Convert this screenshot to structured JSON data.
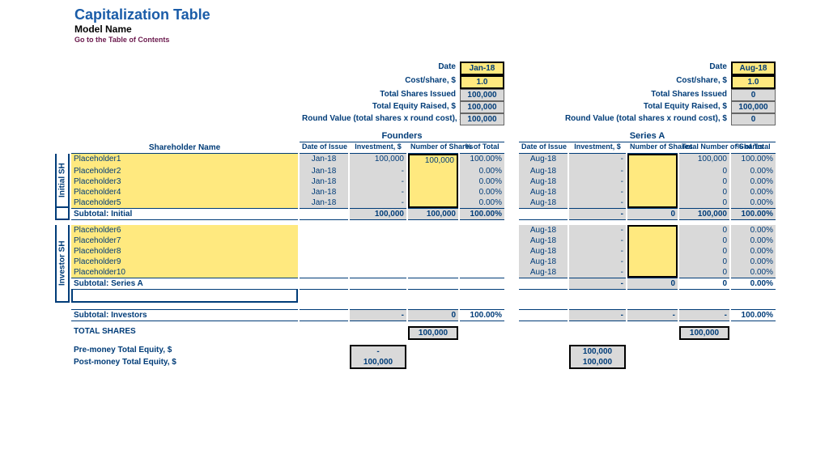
{
  "header": {
    "title": "Capitalization Table",
    "subtitle": "Model Name",
    "toc": "Go to the Table of Contents"
  },
  "labels": {
    "date": "Date",
    "cost": "Cost/share, $",
    "totalShares": "Total Shares Issued",
    "totalEquity": "Total Equity Raised, $",
    "roundValue": "Round Value (total shares x round cost), $",
    "founders": "Founders",
    "seriesA": "Series A",
    "shareholderName": "Shareholder Name",
    "dateOfIssue": "Date of Issue",
    "investment": "Investment, $",
    "numberOfShares": "Number of Shares",
    "totalNumberOfShares": "Total Number of Shares",
    "pctOfTotal": "% of Total",
    "initialSH": "Initial SH",
    "investorSH": "Investor SH",
    "subtotalInitial": "Subtotal: Initial",
    "subtotalSeriesA": "Subtotal: Series A",
    "subtotalInvestors": "Subtotal: Investors",
    "totalSharesLabel": "TOTAL SHARES",
    "preMoney": "Pre-money Total Equity, $",
    "postMoney": "Post-money Total Equity, $"
  },
  "founders": {
    "date": "Jan-18",
    "cost": "1.0",
    "totalShares": "100,000",
    "totalEquity": "100,000",
    "roundValue": "100,000"
  },
  "seriesA": {
    "date": "Aug-18",
    "cost": "1.0",
    "totalShares": "0",
    "totalEquity": "100,000",
    "roundValue": "0"
  },
  "initialRows": [
    {
      "name": "Placeholder1",
      "f_date": "Jan-18",
      "f_inv": "100,000",
      "f_shares": "100,000",
      "f_pct": "100.00%",
      "a_date": "Aug-18",
      "a_inv": "-",
      "a_shares": "",
      "a_total": "100,000",
      "a_pct": "100.00%"
    },
    {
      "name": "Placeholder2",
      "f_date": "Jan-18",
      "f_inv": "-",
      "f_shares": "",
      "f_pct": "0.00%",
      "a_date": "Aug-18",
      "a_inv": "-",
      "a_shares": "",
      "a_total": "0",
      "a_pct": "0.00%"
    },
    {
      "name": "Placeholder3",
      "f_date": "Jan-18",
      "f_inv": "-",
      "f_shares": "",
      "f_pct": "0.00%",
      "a_date": "Aug-18",
      "a_inv": "-",
      "a_shares": "",
      "a_total": "0",
      "a_pct": "0.00%"
    },
    {
      "name": "Placeholder4",
      "f_date": "Jan-18",
      "f_inv": "-",
      "f_shares": "",
      "f_pct": "0.00%",
      "a_date": "Aug-18",
      "a_inv": "-",
      "a_shares": "",
      "a_total": "0",
      "a_pct": "0.00%"
    },
    {
      "name": "Placeholder5",
      "f_date": "Jan-18",
      "f_inv": "-",
      "f_shares": "",
      "f_pct": "0.00%",
      "a_date": "Aug-18",
      "a_inv": "-",
      "a_shares": "",
      "a_total": "0",
      "a_pct": "0.00%"
    }
  ],
  "subtotalInitial": {
    "f_inv": "100,000",
    "f_shares": "100,000",
    "f_pct": "100.00%",
    "a_inv": "-",
    "a_shares": "0",
    "a_total": "100,000",
    "a_pct": "100.00%"
  },
  "investorRows": [
    {
      "name": "Placeholder6",
      "a_date": "Aug-18",
      "a_inv": "-",
      "a_shares": "",
      "a_total": "0",
      "a_pct": "0.00%"
    },
    {
      "name": "Placeholder7",
      "a_date": "Aug-18",
      "a_inv": "-",
      "a_shares": "",
      "a_total": "0",
      "a_pct": "0.00%"
    },
    {
      "name": "Placeholder8",
      "a_date": "Aug-18",
      "a_inv": "-",
      "a_shares": "",
      "a_total": "0",
      "a_pct": "0.00%"
    },
    {
      "name": "Placeholder9",
      "a_date": "Aug-18",
      "a_inv": "-",
      "a_shares": "",
      "a_total": "0",
      "a_pct": "0.00%"
    },
    {
      "name": "Placeholder10",
      "a_date": "Aug-18",
      "a_inv": "-",
      "a_shares": "",
      "a_total": "0",
      "a_pct": "0.00%"
    }
  ],
  "subtotalSeriesA": {
    "a_inv": "-",
    "a_shares": "0",
    "a_total": "",
    "a_pct": "0",
    "a_pct2": "0.00%"
  },
  "subtotalInvestors": {
    "f_inv": "-",
    "f_shares": "0",
    "f_pct": "100.00%",
    "a_inv": "-",
    "a_shares": "-",
    "a_total": "-",
    "a_pct": "100.00%"
  },
  "totals": {
    "f_shares": "100,000",
    "a_total": "100,000",
    "pre_f": "-",
    "post_f": "100,000",
    "pre_a": "100,000",
    "post_a": "100,000"
  }
}
